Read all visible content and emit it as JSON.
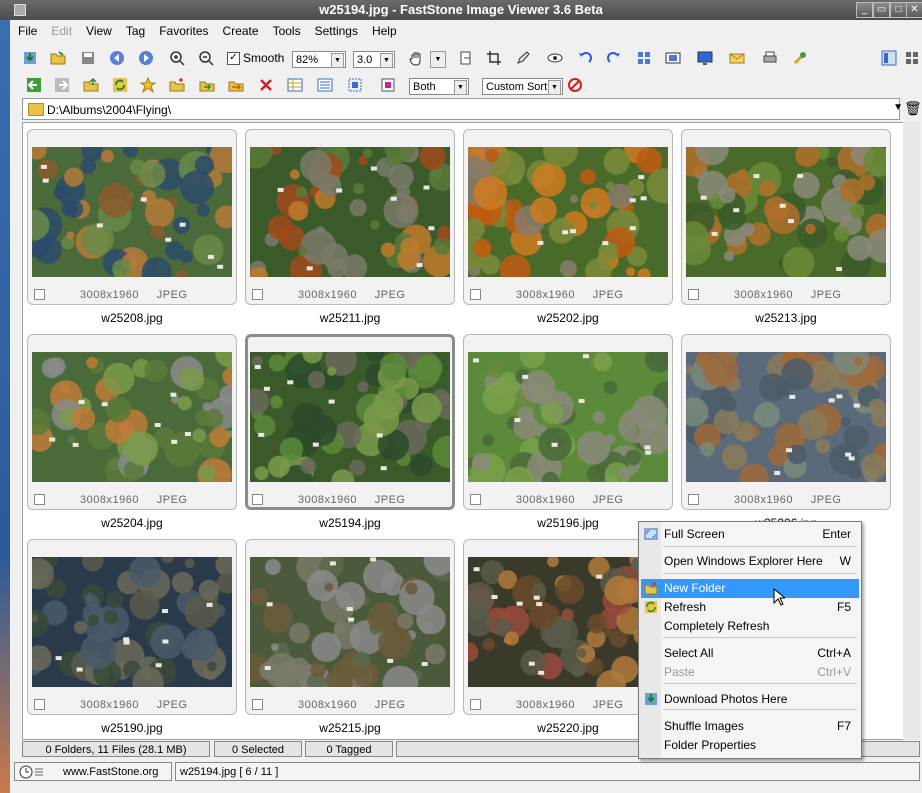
{
  "window": {
    "title": "w25194.jpg  -  FastStone Image Viewer 3.6 Beta",
    "minimize": "_",
    "restore": "▭",
    "maximize": "□",
    "close": "✕"
  },
  "menu": [
    "File",
    "Edit",
    "View",
    "Tag",
    "Favorites",
    "Create",
    "Tools",
    "Settings",
    "Help"
  ],
  "toolbar": {
    "smooth_label": "Smooth",
    "zoom": "82%",
    "gamma": "3.0"
  },
  "toolbar2": {
    "filter": "Both",
    "sort": "Custom Sort"
  },
  "path": "D:\\Albums\\2004\\Flying\\",
  "thumbnails": [
    {
      "name": "w25208.jpg",
      "dims": "3008x1960",
      "format": "JPEG",
      "palette": "a"
    },
    {
      "name": "w25211.jpg",
      "dims": "3008x1960",
      "format": "JPEG",
      "palette": "b"
    },
    {
      "name": "w25202.jpg",
      "dims": "3008x1960",
      "format": "JPEG",
      "palette": "c"
    },
    {
      "name": "w25213.jpg",
      "dims": "3008x1960",
      "format": "JPEG",
      "palette": "d"
    },
    {
      "name": "w25204.jpg",
      "dims": "3008x1960",
      "format": "JPEG",
      "palette": "e"
    },
    {
      "name": "w25194.jpg",
      "dims": "3008x1960",
      "format": "JPEG",
      "palette": "f"
    },
    {
      "name": "w25196.jpg",
      "dims": "3008x1960",
      "format": "JPEG",
      "palette": "g"
    },
    {
      "name": "w25206.jpg",
      "dims": "3008x1960",
      "format": "JPEG",
      "palette": "h"
    },
    {
      "name": "w25190.jpg",
      "dims": "3008x1960",
      "format": "JPEG",
      "palette": "i"
    },
    {
      "name": "w25215.jpg",
      "dims": "3008x1960",
      "format": "JPEG",
      "palette": "j"
    },
    {
      "name": "w25220.jpg",
      "dims": "3008x1960",
      "format": "JPEG",
      "palette": "k"
    }
  ],
  "status": {
    "files": "0 Folders, 11 Files (28.1 MB)",
    "selected": "0 Selected",
    "tagged": "0 Tagged"
  },
  "bottom": {
    "site": "www.FastStone.org",
    "current": "w25194.jpg [ 6 / 11 ]"
  },
  "context_menu": [
    {
      "label": "Full Screen",
      "shortcut": "Enter",
      "icon": "fullscreen-icon"
    },
    {
      "label": "Open Windows Explorer Here",
      "shortcut": "W",
      "icon": ""
    },
    {
      "label": "New Folder",
      "shortcut": "",
      "icon": "new-folder-icon",
      "highlighted": true
    },
    {
      "label": "Refresh",
      "shortcut": "F5",
      "icon": "refresh-icon"
    },
    {
      "label": "Completely Refresh",
      "shortcut": "",
      "icon": ""
    },
    {
      "label": "Select All",
      "shortcut": "Ctrl+A",
      "icon": ""
    },
    {
      "label": "Paste",
      "shortcut": "Ctrl+V",
      "icon": "",
      "disabled": true
    },
    {
      "label": "Download Photos Here",
      "shortcut": "",
      "icon": "download-icon"
    },
    {
      "label": "Shuffle Images",
      "shortcut": "F7",
      "icon": ""
    },
    {
      "label": "Folder Properties",
      "shortcut": "",
      "icon": ""
    }
  ],
  "colors": {
    "highlight": "#3399ff",
    "titlebar": "#4a4a4a"
  }
}
